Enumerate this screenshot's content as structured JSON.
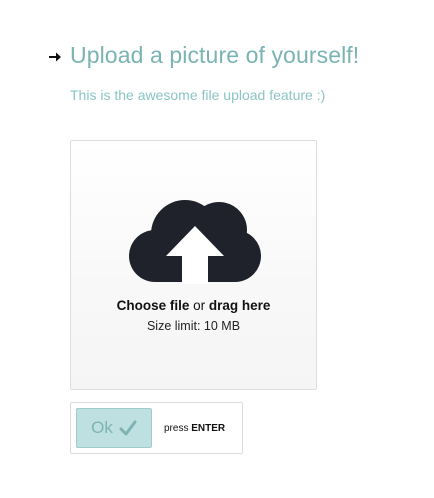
{
  "header": {
    "title": "Upload a picture of yourself!",
    "subtitle": "This is the awesome file upload feature :)",
    "icon": "right-arrow-icon"
  },
  "dropzone": {
    "icon": "cloud-upload-icon",
    "choose_label": "Choose file",
    "or_label": "or",
    "drag_label": "drag here",
    "size_limit": "Size limit: 10 MB"
  },
  "submit": {
    "ok_label": "Ok",
    "icon": "checkmark-icon",
    "press_label": "press",
    "key_label": "ENTER"
  },
  "colors": {
    "accent": "#7ab3b3",
    "button_bg": "#bfe0e0",
    "icon_dark": "#1f222b"
  }
}
